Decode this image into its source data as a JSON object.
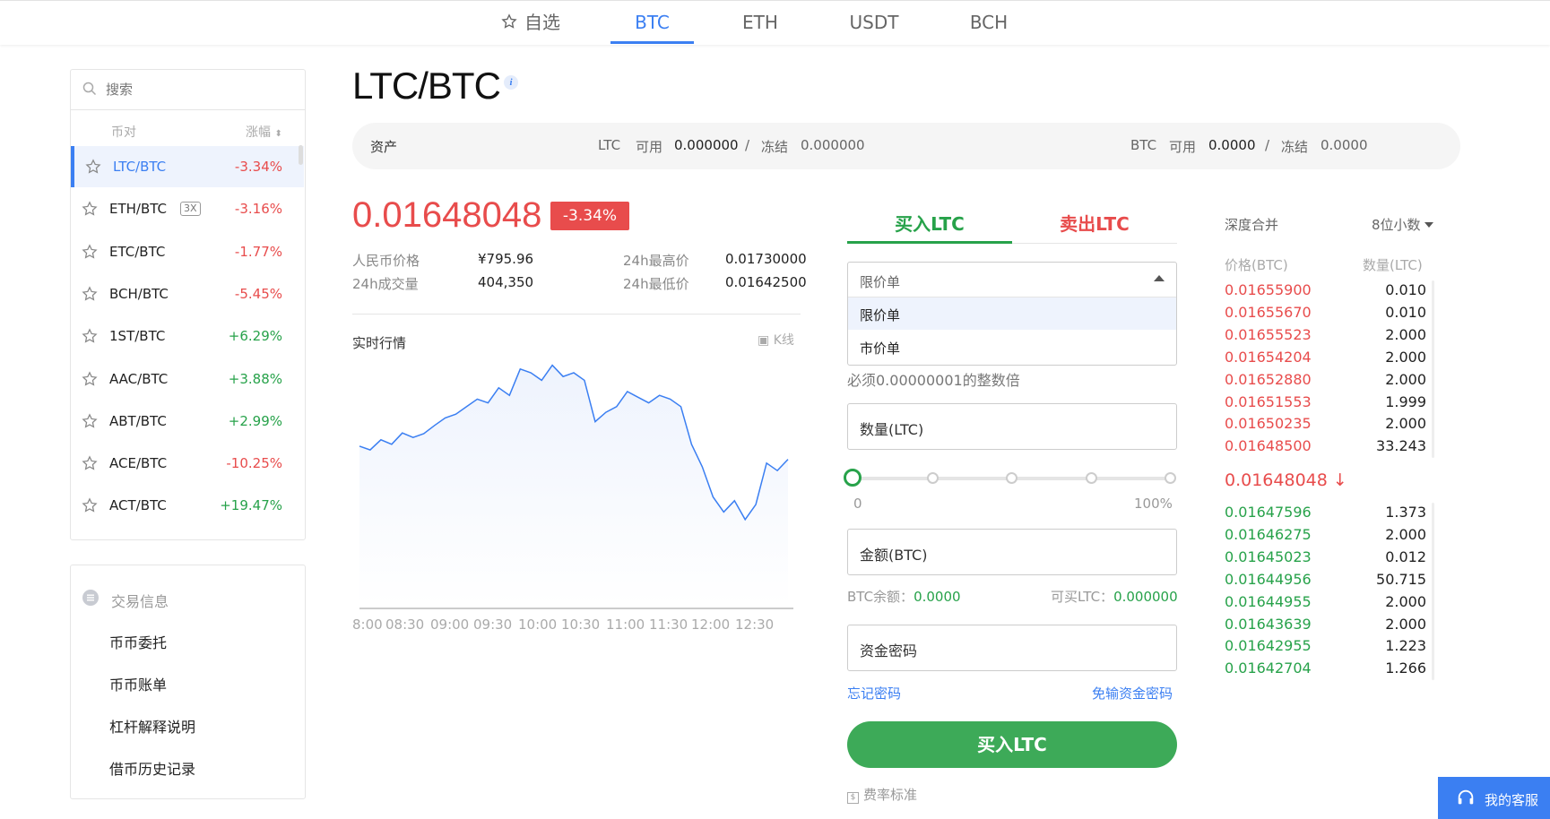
{
  "top_tabs": [
    {
      "label": "自选",
      "active": false
    },
    {
      "label": "BTC",
      "active": true
    },
    {
      "label": "ETH",
      "active": false
    },
    {
      "label": "USDT",
      "active": false
    },
    {
      "label": "BCH",
      "active": false
    }
  ],
  "sidebar": {
    "search_placeholder": "搜索",
    "col_pair": "币对",
    "col_change": "涨幅",
    "markets": [
      {
        "pair": "LTC/BTC",
        "change": "-3.34%",
        "selected": true
      },
      {
        "pair": "ETH/BTC",
        "leverage": "3X",
        "change": "-3.16%"
      },
      {
        "pair": "ETC/BTC",
        "change": "-1.77%"
      },
      {
        "pair": "BCH/BTC",
        "change": "-5.45%"
      },
      {
        "pair": "1ST/BTC",
        "change": "+6.29%"
      },
      {
        "pair": "AAC/BTC",
        "change": "+3.88%"
      },
      {
        "pair": "ABT/BTC",
        "change": "+2.99%"
      },
      {
        "pair": "ACE/BTC",
        "change": "-10.25%"
      },
      {
        "pair": "ACT/BTC",
        "change": "+19.47%"
      }
    ],
    "info_title": "交易信息",
    "info_items": [
      "币币委托",
      "币币账单",
      "杠杆解释说明",
      "借币历史记录"
    ]
  },
  "main": {
    "title": "LTC/BTC",
    "info_icon": "i",
    "assets": {
      "label": "资产",
      "ltc_cur": "LTC",
      "avail_label": "可用",
      "ltc_avail": "0.000000",
      "slash": "/",
      "frozen_label": "冻结",
      "ltc_frozen": "0.000000",
      "btc_cur": "BTC",
      "btc_avail": "0.0000",
      "btc_frozen": "0.0000"
    },
    "last_price": "0.01648048",
    "change_badge": "-3.34%",
    "stats": {
      "cny_label": "人民币价格",
      "cny_value": "¥795.96",
      "high_label": "24h最高价",
      "high_value": "0.01730000",
      "vol_label": "24h成交量",
      "vol_value": "404,350",
      "low_label": "24h最低价",
      "low_value": "0.01642500"
    },
    "chart_title": "实时行情",
    "kline_label": "K线"
  },
  "chart_data": {
    "type": "area",
    "x_ticks": [
      "8:00",
      "08:30",
      "09:00",
      "09:30",
      "10:00",
      "10:30",
      "11:00",
      "11:30",
      "12:00",
      "12:30"
    ],
    "values": [
      0.016655,
      0.016645,
      0.016672,
      0.01666,
      0.01669,
      0.016678,
      0.016688,
      0.01671,
      0.01673,
      0.01674,
      0.01676,
      0.01678,
      0.01677,
      0.01681,
      0.01679,
      0.01686,
      0.01685,
      0.01683,
      0.01687,
      0.01684,
      0.01685,
      0.01683,
      0.01672,
      0.016745,
      0.01676,
      0.0168,
      0.016785,
      0.01677,
      0.01679,
      0.01678,
      0.01676,
      0.01666,
      0.0166,
      0.01652,
      0.01648,
      0.01651,
      0.01646,
      0.0165,
      0.01661,
      0.01659,
      0.01662
    ],
    "colors": {
      "line": "#3b7ff2",
      "fill": "#eef3fd"
    }
  },
  "trade": {
    "buy_tab": "买入LTC",
    "sell_tab": "卖出LTC",
    "order_type_selected": "限价单",
    "order_options": [
      "限价单",
      "市价单"
    ],
    "price_hint": "必须0.00000001的整数倍",
    "qty_placeholder": "数量(LTC)",
    "slider_min": "0",
    "slider_max": "100%",
    "slider_value": 0,
    "amount_placeholder": "金额(BTC)",
    "btc_balance_label": "BTC余额：",
    "btc_balance": "0.0000",
    "can_buy_label": "可买LTC：",
    "can_buy": "0.000000",
    "fund_pwd_placeholder": "资金密码",
    "forgot_pwd": "忘记密码",
    "no_pwd": "免输资金密码",
    "buy_button": "买入LTC",
    "fee_label": "费率标准"
  },
  "orderbook": {
    "depth_label": "深度合并",
    "decimals_label": "8位小数",
    "price_col": "价格(BTC)",
    "qty_col": "数量(LTC)",
    "asks": [
      {
        "price": "0.01655900",
        "qty": "0.010"
      },
      {
        "price": "0.01655670",
        "qty": "0.010"
      },
      {
        "price": "0.01655523",
        "qty": "2.000"
      },
      {
        "price": "0.01654204",
        "qty": "2.000"
      },
      {
        "price": "0.01652880",
        "qty": "2.000"
      },
      {
        "price": "0.01651553",
        "qty": "1.999"
      },
      {
        "price": "0.01650235",
        "qty": "2.000"
      },
      {
        "price": "0.01648500",
        "qty": "33.243"
      }
    ],
    "last": "0.01648048",
    "last_arrow": "↓",
    "bids": [
      {
        "price": "0.01647596",
        "qty": "1.373"
      },
      {
        "price": "0.01646275",
        "qty": "2.000"
      },
      {
        "price": "0.01645023",
        "qty": "0.012"
      },
      {
        "price": "0.01644956",
        "qty": "50.715"
      },
      {
        "price": "0.01644955",
        "qty": "2.000"
      },
      {
        "price": "0.01643639",
        "qty": "2.000"
      },
      {
        "price": "0.01642955",
        "qty": "1.223"
      },
      {
        "price": "0.01642704",
        "qty": "1.266"
      }
    ]
  },
  "customer_service": "我的客服"
}
